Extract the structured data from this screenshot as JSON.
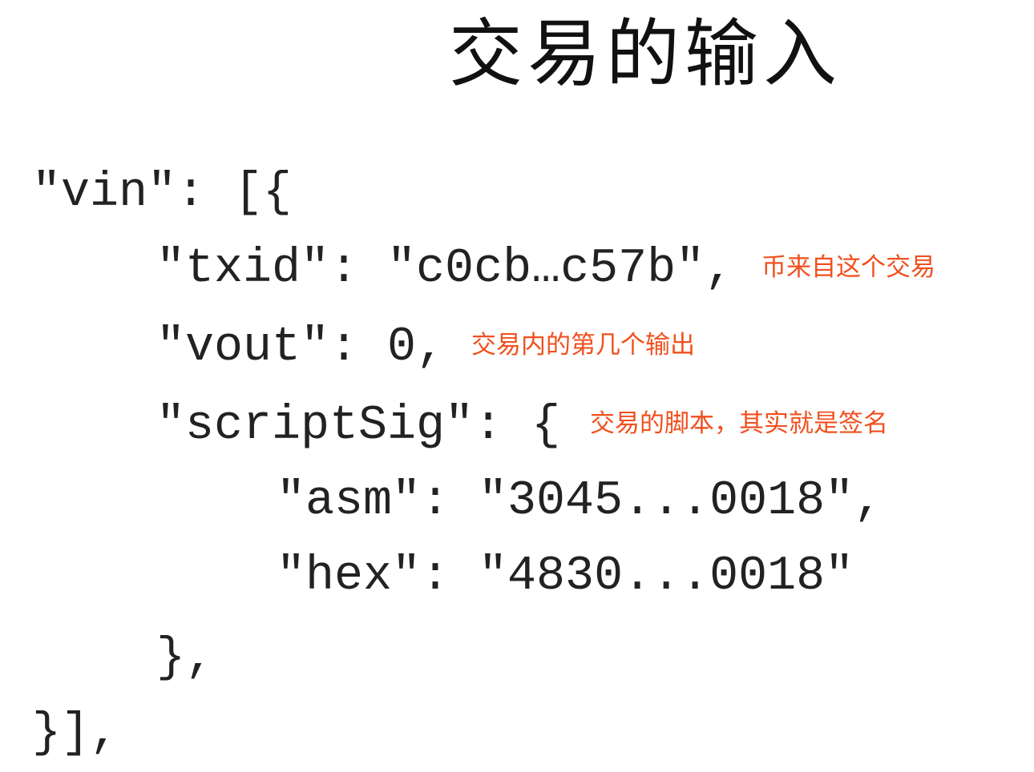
{
  "title": "交易的输入",
  "code": {
    "line1": "\"vin\": [{",
    "line2": "\"txid\": \"c0cb…c57b\",",
    "line3": "\"vout\": 0,",
    "line4": "\"scriptSig\": {",
    "line5": "\"asm\": \"3045...0018\",",
    "line6": "\"hex\": \"4830...0018\"",
    "line7": "},",
    "line8": "}],"
  },
  "annotations": {
    "txid_note": "币来自这个交易",
    "vout_note": "交易内的第几个输出",
    "scriptsig_note": "交易的脚本，其实就是签名"
  },
  "colors": {
    "text": "#222222",
    "annotation": "#f0501e",
    "background": "#ffffff"
  }
}
